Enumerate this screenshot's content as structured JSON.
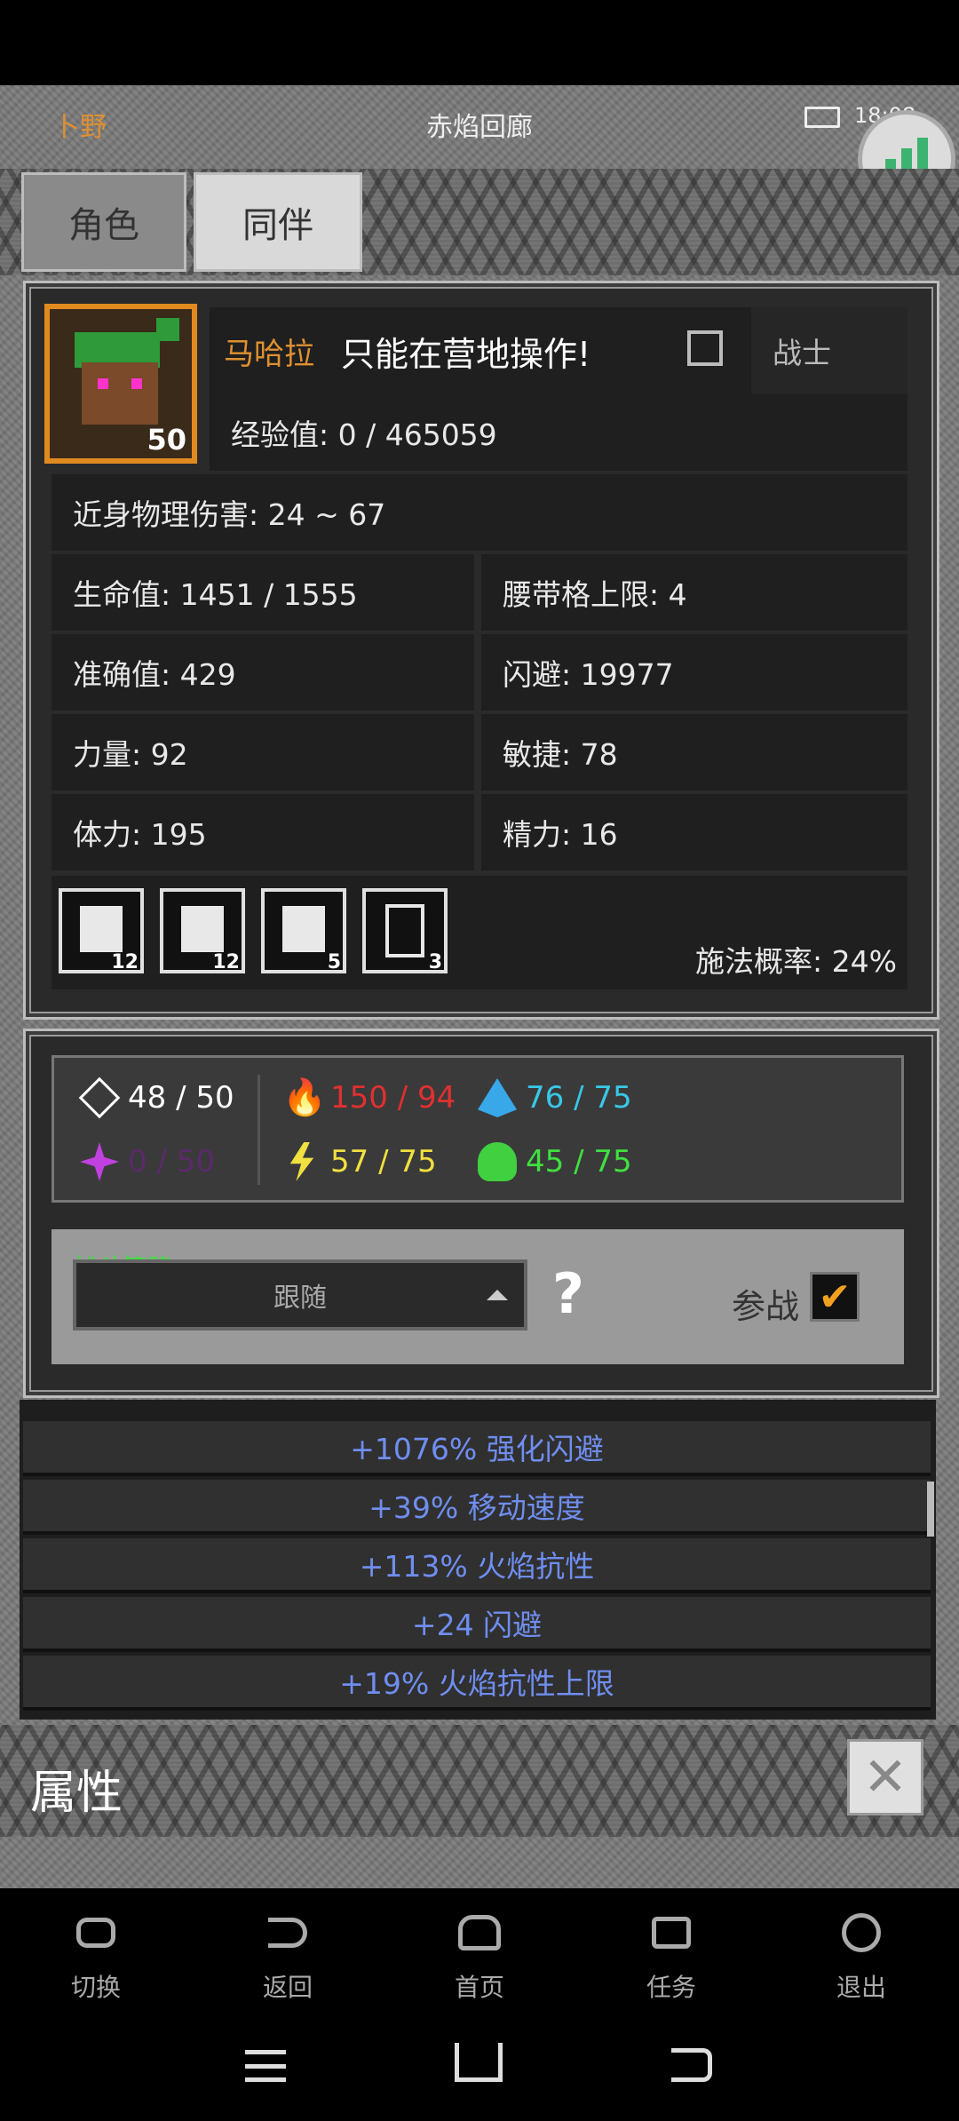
{
  "status_bar": {
    "left_text": "卜野",
    "title": "赤焰回廊",
    "time": "18:08"
  },
  "tabs": [
    {
      "label": "角色"
    },
    {
      "label": "同伴"
    }
  ],
  "character": {
    "name": "马哈拉",
    "level": "50",
    "notice": "只能在营地操作!",
    "class": "战士",
    "exp": "经验值: 0 / 465059",
    "melee": "近身物理伤害: 24 ~ 67",
    "hp": "生命值: 1451 / 1555",
    "belt": "腰带格上限: 4",
    "accuracy": "准确值: 429",
    "dodge": "闪避: 19977",
    "strength": "力量: 92",
    "agility": "敏捷: 78",
    "stamina": "体力: 195",
    "energy": "精力: 16",
    "cast_rate": "施法概率: 24%"
  },
  "skills": [
    {
      "count": "12"
    },
    {
      "count": "12"
    },
    {
      "count": "5"
    },
    {
      "count": "3"
    }
  ],
  "resistances": {
    "physical": "48 / 50",
    "fire": "150 / 94",
    "ice": "76 / 75",
    "arcane": "0 / 50",
    "lightning": "57 / 75",
    "poison": "45 / 75"
  },
  "strategy": {
    "label": "战斗策略",
    "value": "跟随",
    "help": "?",
    "join_label": "参战"
  },
  "attributes": [
    "+1076% 强化闪避",
    "+39% 移动速度",
    "+113% 火焰抗性",
    "+24 闪避",
    "+19% 火焰抗性上限"
  ],
  "attr_panel_title": "属性",
  "nav": [
    {
      "label": "切换"
    },
    {
      "label": "返回"
    },
    {
      "label": "首页"
    },
    {
      "label": "任务"
    },
    {
      "label": "退出"
    }
  ],
  "colors": {
    "fire": "#e03030",
    "ice": "#38c8e8",
    "arcane": "#5a2a6a",
    "lightning": "#f0e040",
    "poison": "#40e040",
    "gold_name": "#e09030",
    "attr_text": "#6f8ef0"
  }
}
